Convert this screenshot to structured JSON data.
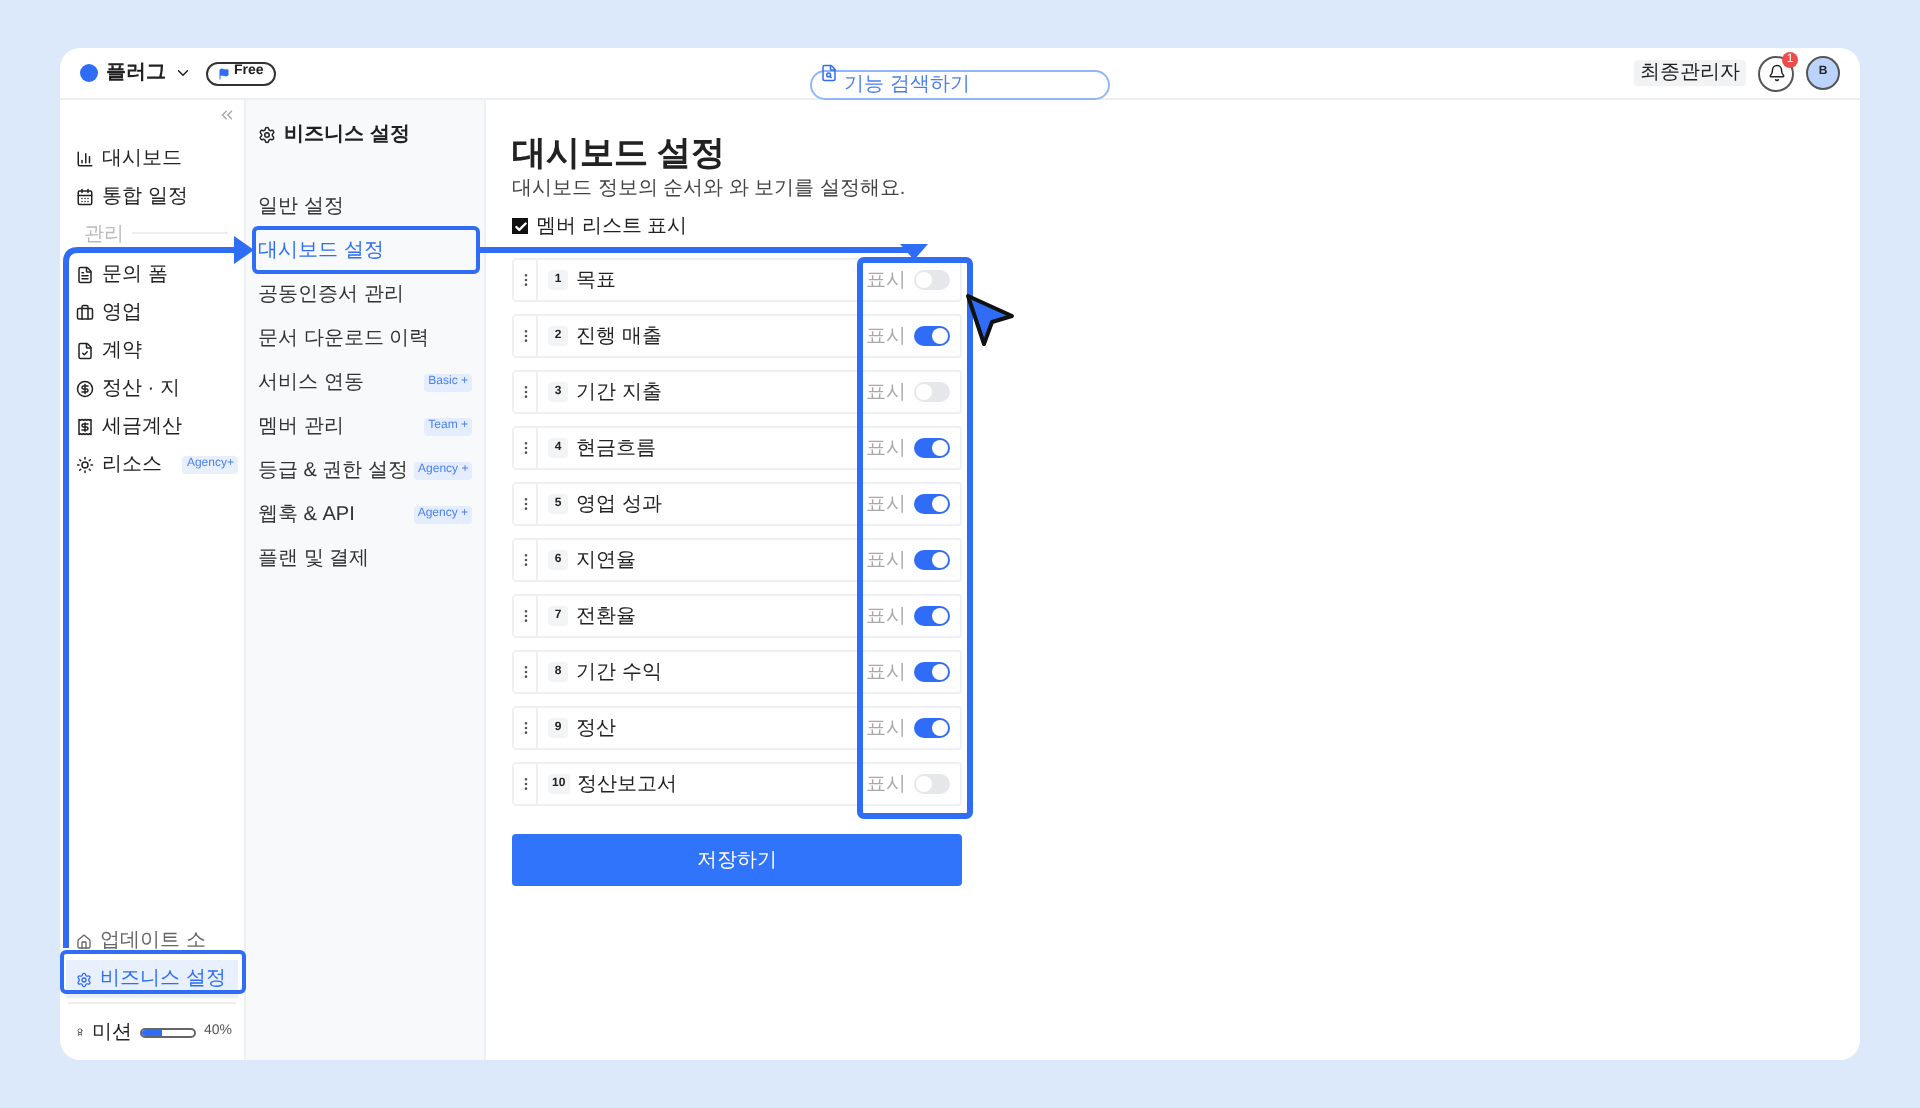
{
  "header": {
    "brand": "플러그",
    "plan": "Free",
    "search": {
      "placeholder": "기능 검색하기"
    },
    "role": "최종관리자",
    "notifications": "1",
    "avatar": "B"
  },
  "sidebar": {
    "items": [
      {
        "kind": "item",
        "label": "대시보드",
        "selected": false
      },
      {
        "kind": "item",
        "label": "통합 일정",
        "selected": false
      },
      {
        "kind": "section",
        "label": "관리"
      },
      {
        "kind": "item",
        "label": "문의 폼",
        "selected": false
      },
      {
        "kind": "item",
        "label": "영업",
        "selected": false
      },
      {
        "kind": "item",
        "label": "계약",
        "selected": false
      },
      {
        "kind": "item",
        "label": "정산 · 지",
        "selected": false
      },
      {
        "kind": "item",
        "label": "세금계산",
        "selected": false
      },
      {
        "kind": "item",
        "label": "리소스",
        "badge": "Agency+",
        "selected": false
      }
    ],
    "footer_items": [
      {
        "label": "업데이트 소",
        "selected": false
      },
      {
        "label": "비즈니스 설정",
        "selected": true
      }
    ],
    "mission": {
      "label": "미션",
      "level": 0.4,
      "reading": "40%"
    }
  },
  "settings_menu": {
    "title": "비즈니스 설정",
    "items": [
      {
        "label": "일반 설정",
        "selected": false
      },
      {
        "label": "대시보드 설정",
        "selected": true
      },
      {
        "label": "공동인증서 관리",
        "selected": false
      },
      {
        "label": "문서 다운로드 이력",
        "selected": false
      },
      {
        "label": "서비스 연동",
        "badge": "Basic +",
        "selected": false
      },
      {
        "label": "멤버 관리",
        "badge": "Team +",
        "selected": false
      },
      {
        "label": "등급 & 권한 설정",
        "badge": "Agency +",
        "selected": false
      },
      {
        "label": "웹훅 & API",
        "badge": "Agency +",
        "selected": false
      },
      {
        "label": "플랜 및 결제",
        "selected": false
      }
    ]
  },
  "main": {
    "title": "대시보드 설정",
    "subtitle": "대시보드 정보의 순서와 와 보기를 설정해요.",
    "member_list": {
      "label": "멤버 리스트 표시",
      "checked": true
    },
    "rows": [
      {
        "number": "1",
        "label": "목표",
        "toggle_label": "표시",
        "on": false
      },
      {
        "number": "2",
        "label": "진행 매출",
        "toggle_label": "표시",
        "on": true
      },
      {
        "number": "3",
        "label": "기간 지출",
        "toggle_label": "표시",
        "on": false
      },
      {
        "number": "4",
        "label": "현금흐름",
        "toggle_label": "표시",
        "on": true
      },
      {
        "number": "5",
        "label": "영업 성과",
        "toggle_label": "표시",
        "on": true
      },
      {
        "number": "6",
        "label": "지연율",
        "toggle_label": "표시",
        "on": true
      },
      {
        "number": "7",
        "label": "전환율",
        "toggle_label": "표시",
        "on": true
      },
      {
        "number": "8",
        "label": "기간 수익",
        "toggle_label": "표시",
        "on": true
      },
      {
        "number": "9",
        "label": "정산",
        "toggle_label": "표시",
        "on": true
      },
      {
        "number": "10",
        "label": "정산보고서",
        "toggle_label": "표시",
        "on": false
      }
    ],
    "save_button": "저장하기"
  }
}
